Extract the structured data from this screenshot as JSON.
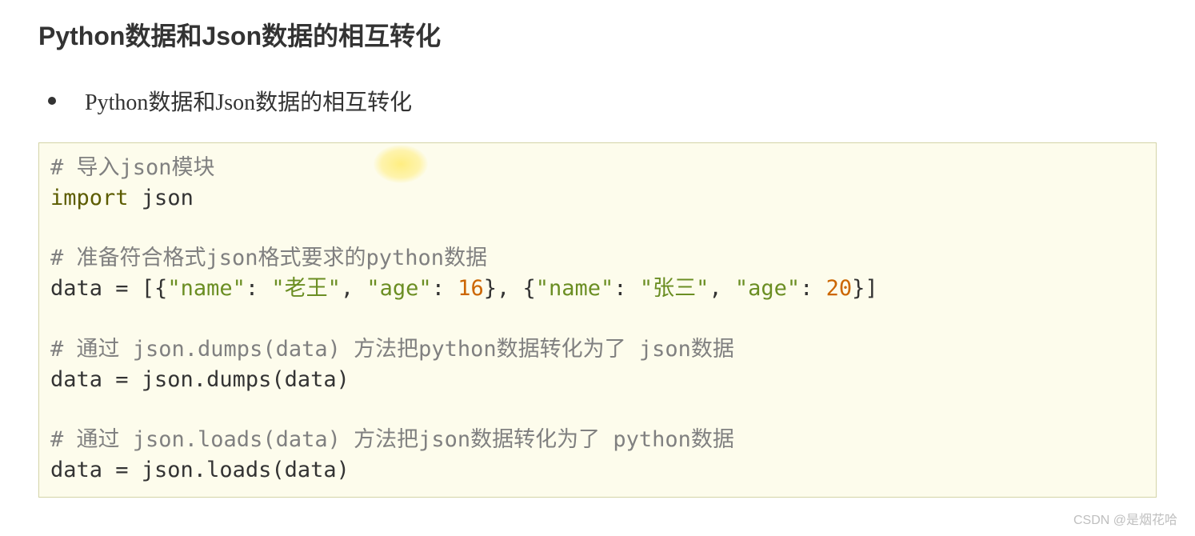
{
  "title": "Python数据和Json数据的相互转化",
  "bullet": "Python数据和Json数据的相互转化",
  "code": {
    "c1": "# 导入json模块",
    "kw_import": "import",
    "mod": " json",
    "c2": "# 准备符合格式json格式要求的python数据",
    "l3_p1": "data = [{",
    "l3_s1": "\"name\"",
    "l3_p2": ": ",
    "l3_s2": "\"老王\"",
    "l3_p3": ", ",
    "l3_s3": "\"age\"",
    "l3_p4": ": ",
    "l3_n1": "16",
    "l3_p5": "}, {",
    "l3_s4": "\"name\"",
    "l3_p6": ": ",
    "l3_s5": "\"张三\"",
    "l3_p7": ", ",
    "l3_s6": "\"age\"",
    "l3_p8": ": ",
    "l3_n2": "20",
    "l3_p9": "}]",
    "c3": "# 通过 json.dumps(data) 方法把python数据转化为了 json数据",
    "l5": "data = json.dumps(data)",
    "c4": "# 通过 json.loads(data) 方法把json数据转化为了 python数据",
    "l7": "data = json.loads(data)"
  },
  "watermark": "CSDN @是烟花哈"
}
